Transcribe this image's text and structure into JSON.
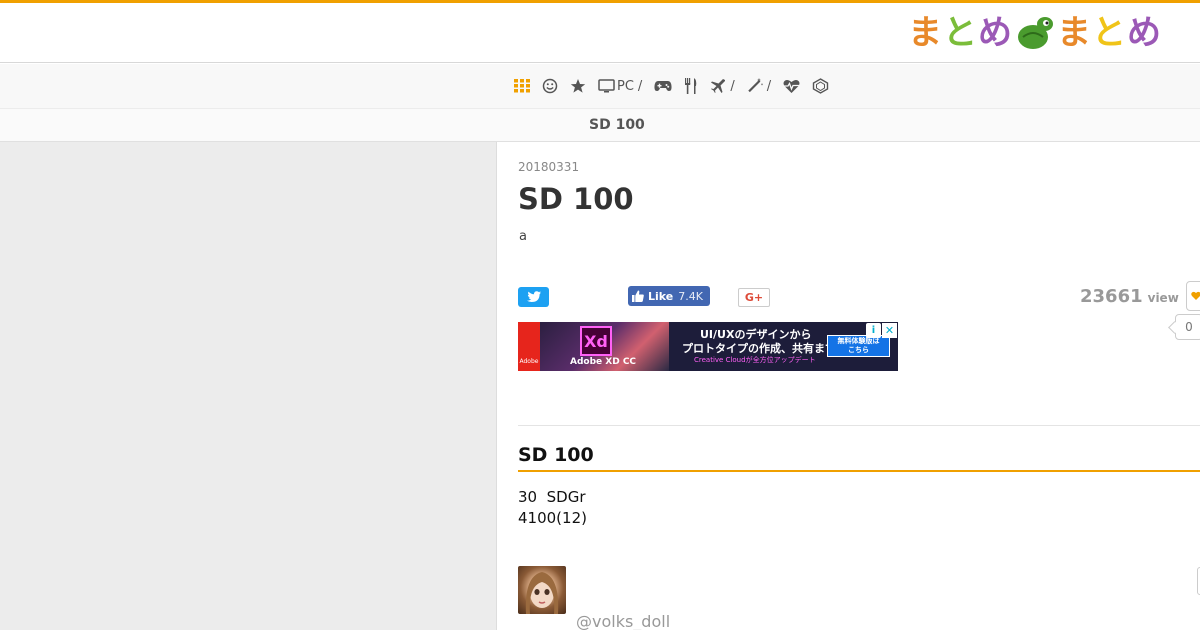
{
  "site": {
    "logo_part1": "まとめ",
    "logo_part2": "まとめ",
    "accent_color": "#f0a000"
  },
  "nav": {
    "items": [
      {
        "icon": "grid-icon",
        "label": "",
        "sep": ""
      },
      {
        "icon": "smiley-icon",
        "label": "",
        "sep": ""
      },
      {
        "icon": "star-icon",
        "label": "",
        "sep": ""
      },
      {
        "icon": "monitor-icon",
        "label": "PC",
        "sep": "/"
      },
      {
        "icon": "gamepad-icon",
        "label": "",
        "sep": ""
      },
      {
        "icon": "fork-knife-icon",
        "label": "",
        "sep": ""
      },
      {
        "icon": "airplane-icon",
        "label": "",
        "sep": "/"
      },
      {
        "icon": "magic-wand-icon",
        "label": "",
        "sep": "/"
      },
      {
        "icon": "heartbeat-icon",
        "label": "",
        "sep": ""
      },
      {
        "icon": "diamond-icon",
        "label": "",
        "sep": ""
      }
    ]
  },
  "breadcrumb": {
    "current": "SD 100"
  },
  "article": {
    "date": "20180331",
    "title": "SD 100",
    "description": "a",
    "share": {
      "facebook_like": "Like",
      "facebook_count": "7.4K",
      "gplus": "G+"
    },
    "views": {
      "count": "23661",
      "label": "view"
    },
    "favorites": {
      "count": "0"
    },
    "ad": {
      "brand": "Adobe",
      "product_badge": "Xd",
      "product_name": "Adobe XD CC",
      "line1": "UI/UXのデザインから",
      "line2": "プロトタイプの作成、共有まで",
      "line3": "Creative Cloudが全方位アップデート",
      "cta": "無料体験版は\nこちら",
      "info": "i",
      "close": "✕"
    },
    "section_heading": "SD 100",
    "body_lines": [
      "30  SDGr",
      "4100(12)"
    ],
    "author": {
      "username": "@volks_doll"
    }
  }
}
